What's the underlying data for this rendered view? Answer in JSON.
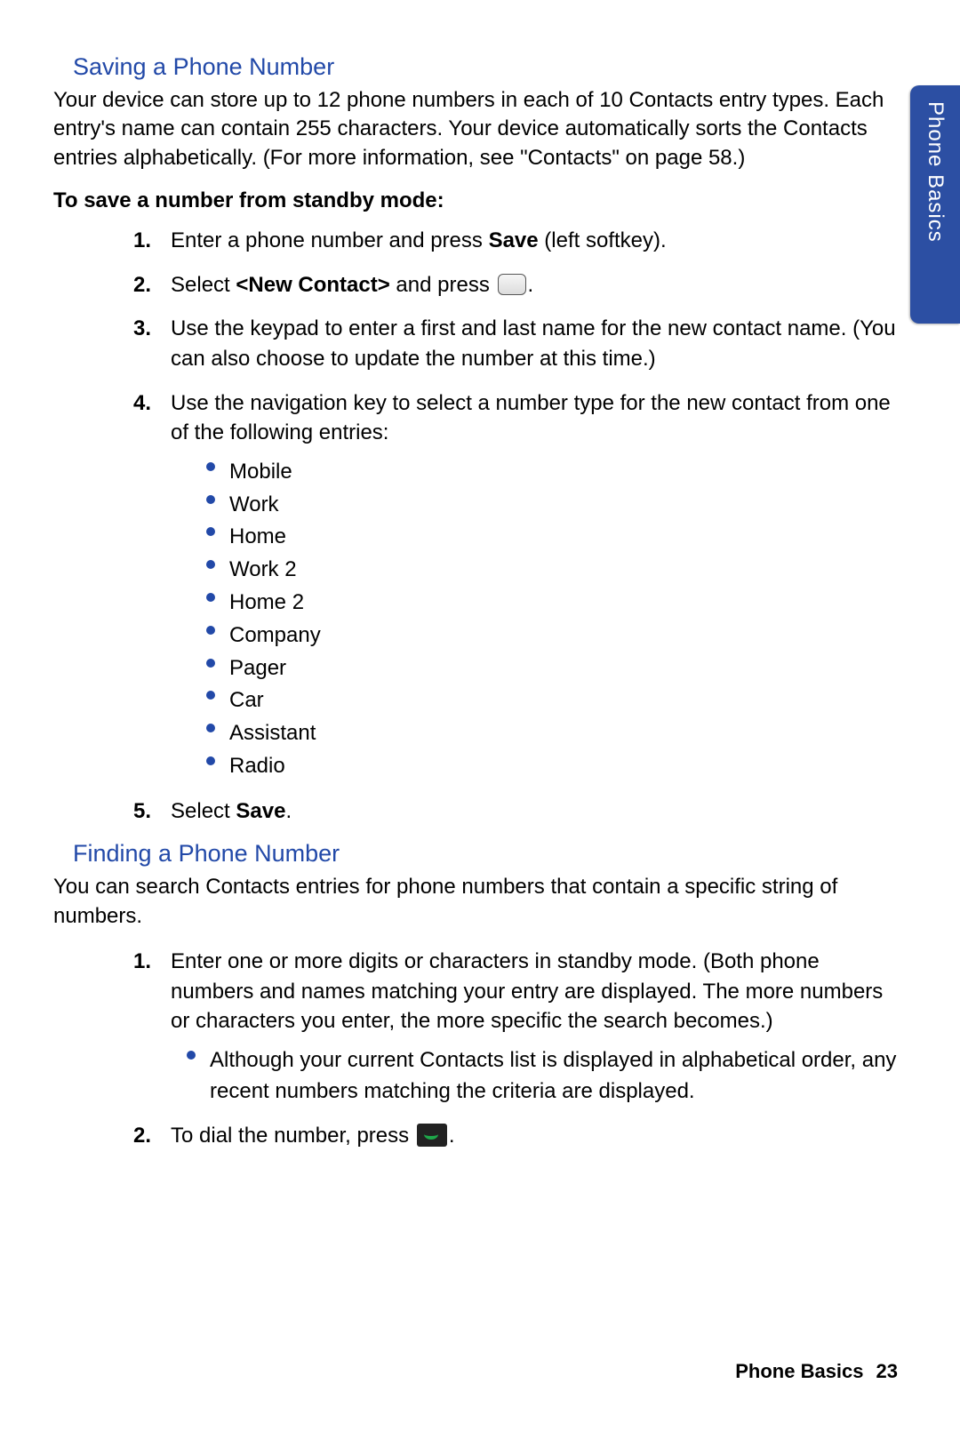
{
  "sideTab": "Phone Basics",
  "section1": {
    "heading": "Saving a Phone Number",
    "intro": "Your device can store up to 12 phone numbers in each of 10 Contacts entry types. Each entry's name can contain 255 characters. Your device automatically sorts the Contacts entries alphabetically. (For more information, see \"Contacts\" on page 58.)",
    "subheading": "To save a number from standby mode:",
    "steps": {
      "s1_a": "Enter a phone number and press ",
      "s1_b": "Save",
      "s1_c": " (left softkey).",
      "s2_a": "Select ",
      "s2_b": "<New Contact>",
      "s2_c": " and press ",
      "s2_d": ".",
      "s3": "Use the keypad to enter a first and last name for the new contact name. (You can also choose to update the number at this time.)",
      "s4": "Use the navigation key to select a number type for the new contact from one of the following entries:",
      "bullets": [
        "Mobile",
        "Work",
        "Home",
        "Work 2",
        "Home 2",
        "Company",
        "Pager",
        "Car",
        "Assistant",
        "Radio"
      ],
      "s5_a": "Select ",
      "s5_b": "Save",
      "s5_c": "."
    }
  },
  "section2": {
    "heading": "Finding a Phone Number",
    "intro": "You can search Contacts entries for phone numbers that contain a specific string of numbers.",
    "steps": {
      "s1": "Enter one or more digits or characters in standby mode. (Both phone numbers and names matching your entry are displayed. The more numbers or characters you enter, the more specific the search becomes.)",
      "s1_sub": "Although your current Contacts list is displayed in alphabetical order, any recent numbers matching the criteria are displayed.",
      "s2_a": "To dial the number, press ",
      "s2_b": "."
    }
  },
  "footer": {
    "label": "Phone Basics",
    "page": "23"
  }
}
